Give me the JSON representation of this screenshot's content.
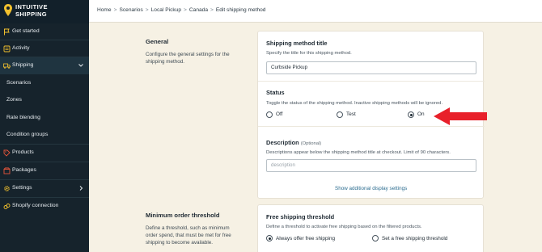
{
  "brand": {
    "line1": "INTUITIVE",
    "line2": "SHIPPING"
  },
  "sidebar": {
    "items": [
      {
        "label": "Get started",
        "icon": "flag-icon"
      },
      {
        "label": "Activity",
        "icon": "list-icon"
      },
      {
        "label": "Shipping",
        "icon": "truck-icon"
      },
      {
        "label": "Scenarios"
      },
      {
        "label": "Zones"
      },
      {
        "label": "Rate blending"
      },
      {
        "label": "Condition groups"
      },
      {
        "label": "Products",
        "icon": "tag-icon"
      },
      {
        "label": "Packages",
        "icon": "box-icon"
      },
      {
        "label": "Settings",
        "icon": "gear-icon"
      },
      {
        "label": "Shopify connection",
        "icon": "link-icon"
      }
    ]
  },
  "breadcrumb": [
    "Home",
    "Scenarios",
    "Local Pickup",
    "Canada",
    "Edit shipping method"
  ],
  "general": {
    "title": "General",
    "desc": "Configure the general settings for the shipping method.",
    "method_title": {
      "label": "Shipping method title",
      "help": "Specify the title for this shipping method.",
      "value": "Curbside Pickup"
    },
    "status": {
      "label": "Status",
      "help": "Toggle the status of the shipping method. Inactive shipping methods will be ignored.",
      "options": [
        "Off",
        "Test",
        "On"
      ],
      "selected": "On"
    },
    "description": {
      "label": "Description",
      "optional": "(Optional)",
      "help": "Descriptions appear below the shipping method title at checkout. Limit of 90 characters.",
      "placeholder": "description"
    },
    "more_link": "Show additional display settings"
  },
  "threshold": {
    "title": "Minimum order threshold",
    "desc": "Define a threshold, such as minimum order spend, that must be met for free shipping to become available.",
    "free_shipping": {
      "label": "Free shipping threshold",
      "help": "Define a threshold to activate free shipping based on the filtered products.",
      "options": [
        "Always offer free shipping",
        "Set a free shipping threshold"
      ],
      "selected": "Always offer free shipping"
    }
  },
  "colors": {
    "sidebar_bg": "#16232c",
    "page_bg": "#f6f1e4",
    "accent_yellow": "#f2c12e",
    "arrow_red": "#e8202a"
  }
}
